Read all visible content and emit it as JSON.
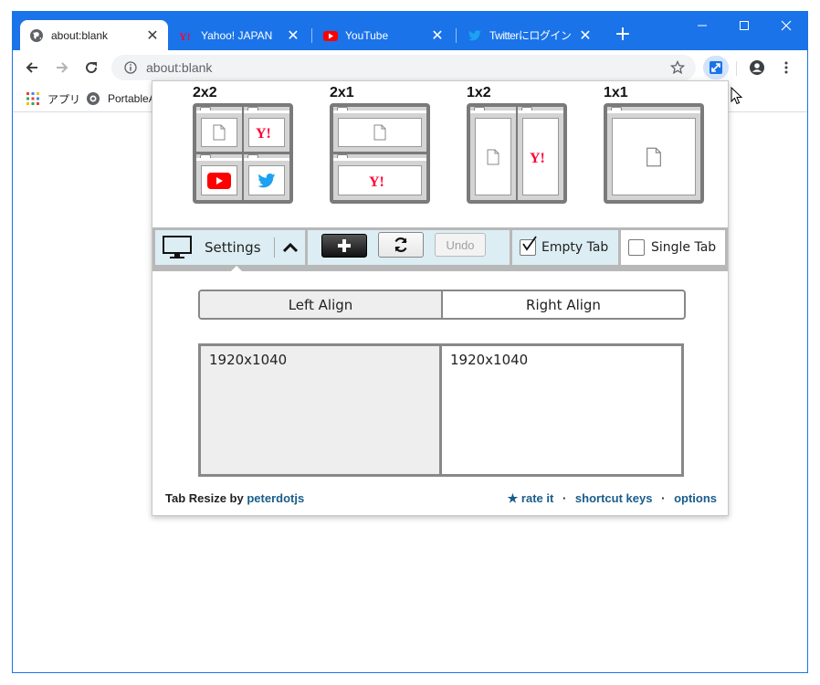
{
  "browser": {
    "tabs": [
      {
        "title": "about:blank",
        "icon": "globe-icon",
        "active": true
      },
      {
        "title": "Yahoo! JAPAN",
        "icon": "yahoo-icon",
        "active": false
      },
      {
        "title": "YouTube",
        "icon": "youtube-icon",
        "active": false
      },
      {
        "title": "Twitterにログイン",
        "icon": "twitter-icon",
        "active": false
      }
    ],
    "new_tab": "+",
    "close_glyph": "✕",
    "window_controls": {
      "minimize": "—",
      "maximize": "☐",
      "close": "✕"
    },
    "address": "about:blank",
    "bookmarks": [
      {
        "label": "アプリ",
        "icon": "apps-grid-icon"
      },
      {
        "label": "PortableA",
        "icon": "site-icon"
      }
    ],
    "accent_color": "#1a73e8"
  },
  "popup": {
    "layouts": [
      {
        "label": "2x2"
      },
      {
        "label": "2x1"
      },
      {
        "label": "1x2"
      },
      {
        "label": "1x1"
      }
    ],
    "controls": {
      "settings_label": "Settings",
      "undo_label": "Undo",
      "empty_tab_label": "Empty Tab",
      "empty_tab_checked": true,
      "single_tab_label": "Single Tab",
      "single_tab_checked": false
    },
    "align": {
      "left_label": "Left Align",
      "right_label": "Right Align",
      "selected": "left"
    },
    "screens": [
      {
        "resolution": "1920x1040",
        "selected": true
      },
      {
        "resolution": "1920x1040",
        "selected": false
      }
    ],
    "footer": {
      "app_name": "Tab Resize by",
      "author": "peterdotjs",
      "rate": "★ rate it",
      "sep1": "·",
      "shortcuts": "shortcut keys",
      "sep2": "·",
      "options": "options"
    }
  }
}
